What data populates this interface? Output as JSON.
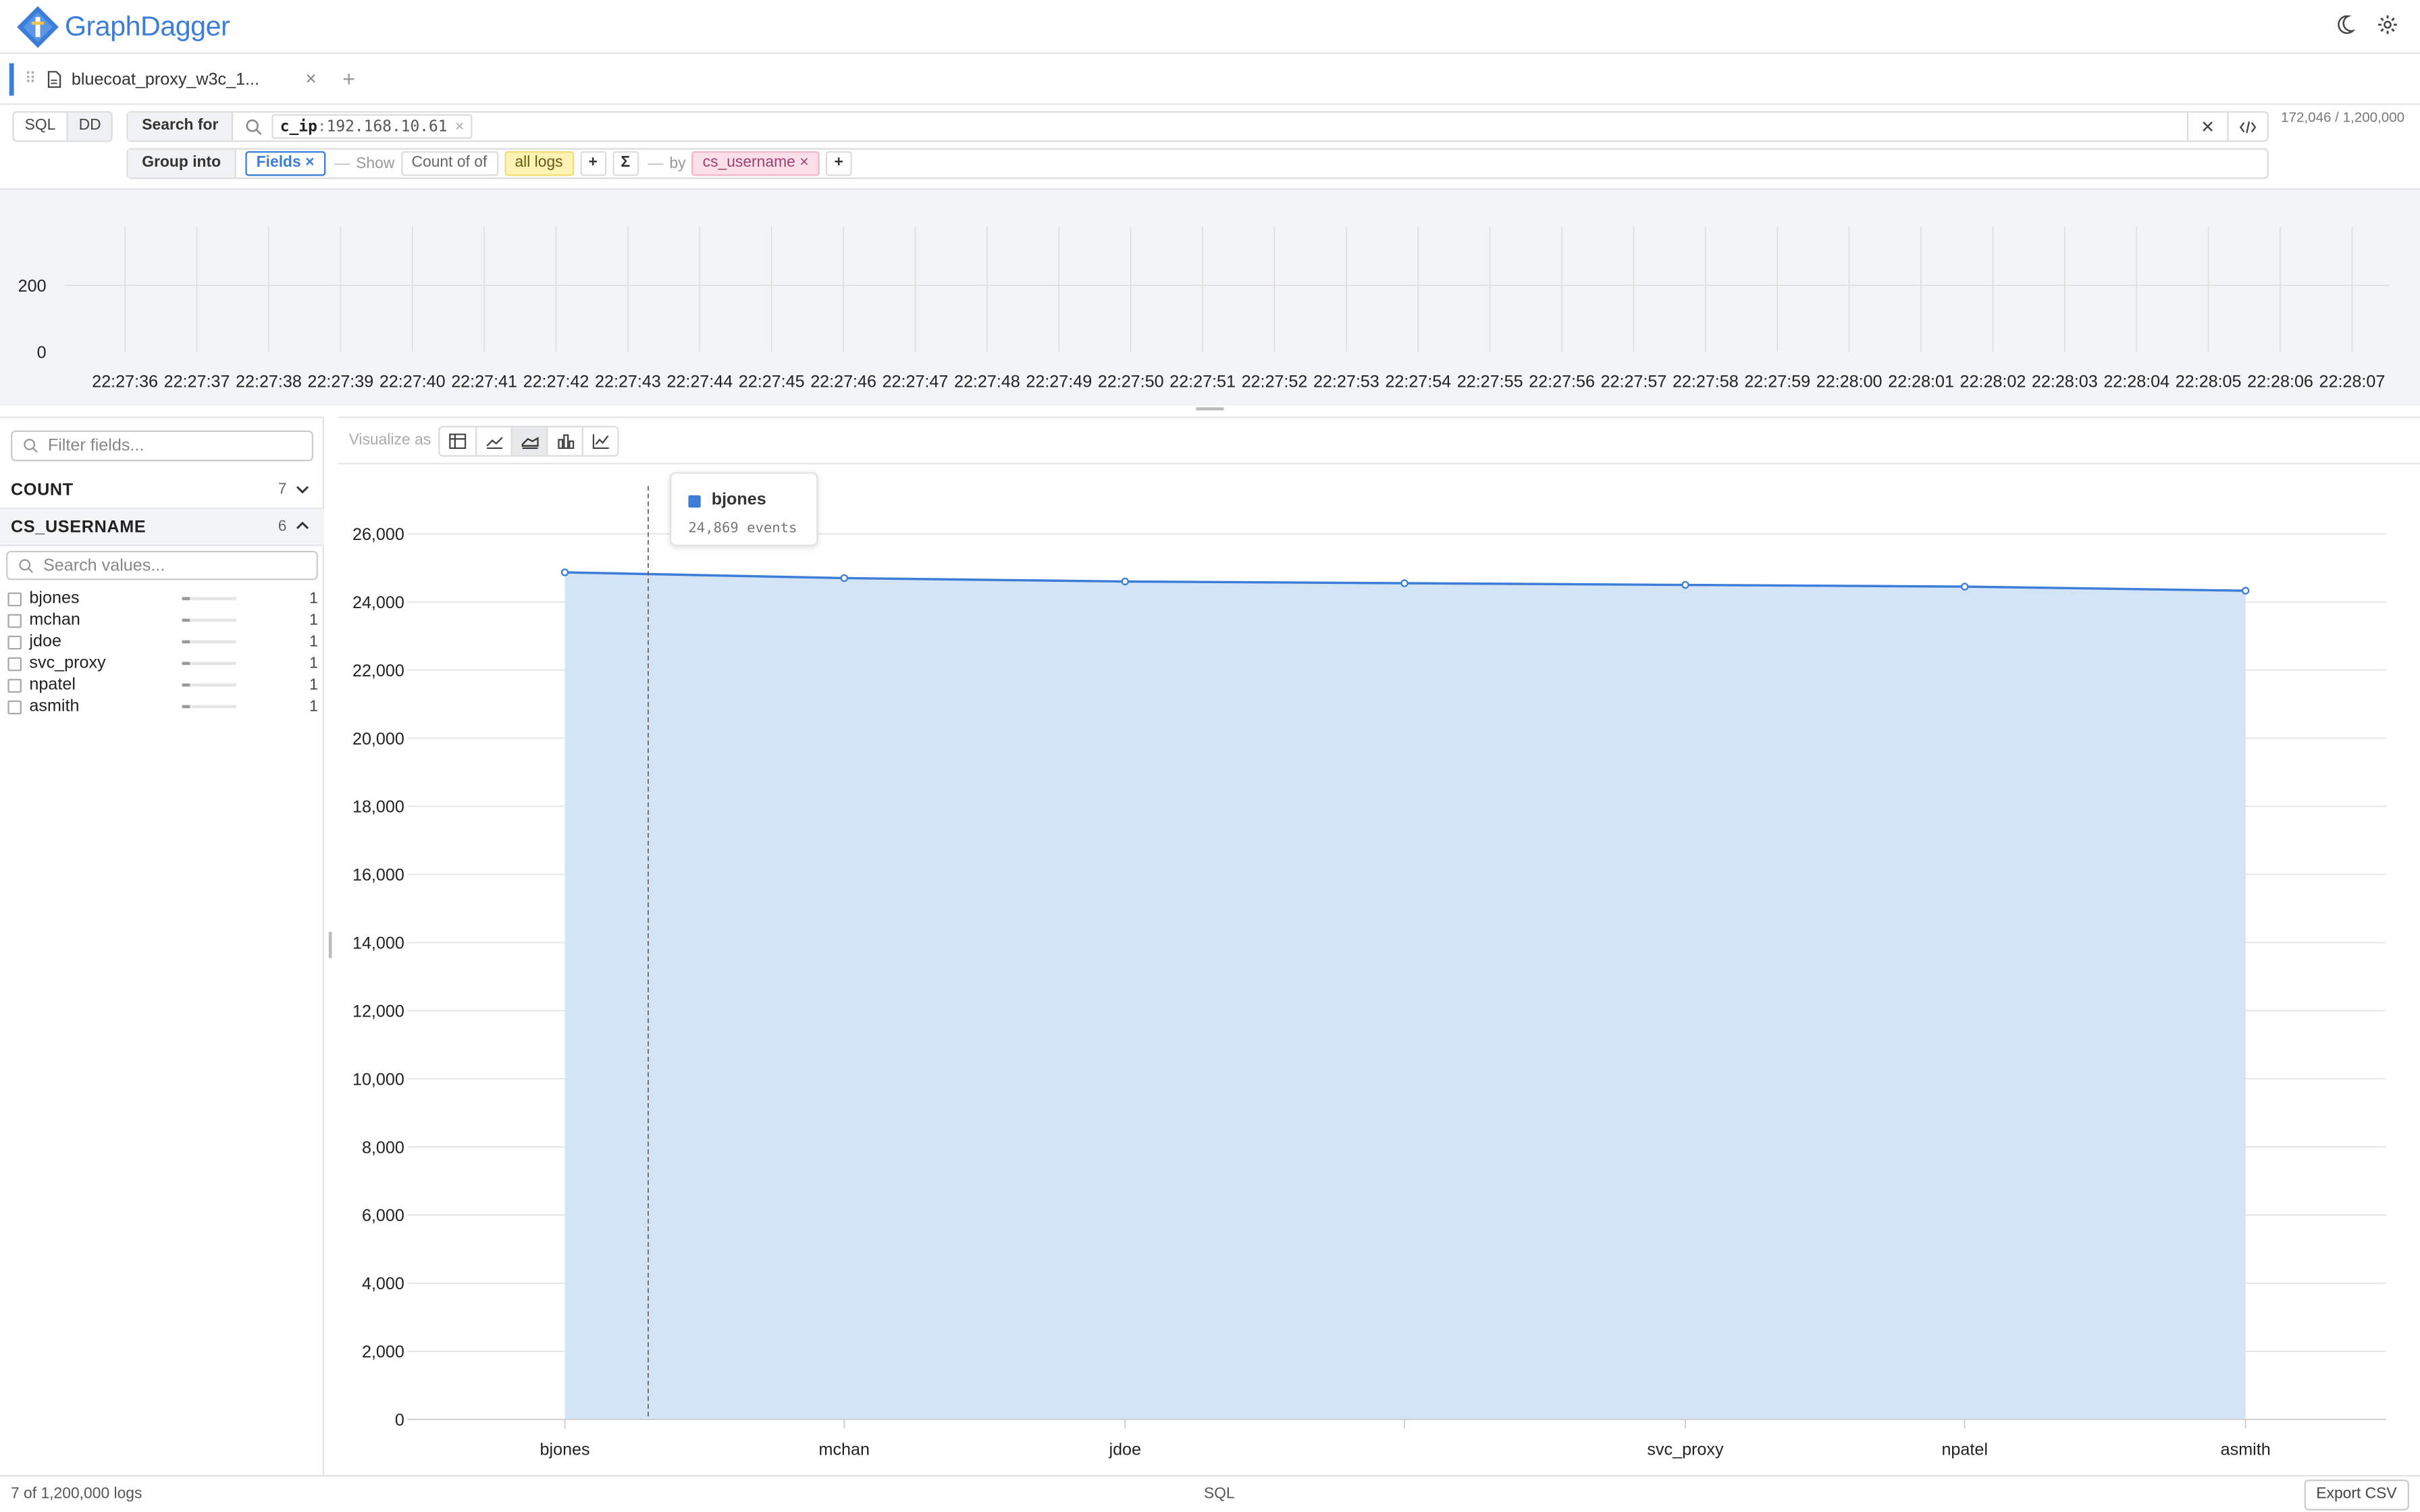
{
  "app": {
    "name": "GraphDagger"
  },
  "tabs": [
    {
      "label": "bluecoat_proxy_w3c_1..."
    }
  ],
  "mode": {
    "sql": "SQL",
    "dd": "DD"
  },
  "search": {
    "label": "Search for",
    "chip_key": "c_ip",
    "chip_sep": ":",
    "chip_value": "192.168.10.61"
  },
  "counter": "172,046 / 1,200,000",
  "group": {
    "label": "Group into",
    "fields_chip": "Fields",
    "show_word": "Show",
    "metric": "Count of of",
    "scope": "all logs",
    "plus": "+",
    "sigma": "Σ",
    "by_word": "by",
    "by_field": "cs_username",
    "plus2": "+"
  },
  "histogram": {
    "y_ticks": [
      "200",
      "0"
    ],
    "x_ticks": [
      "22:27:36",
      "22:27:37",
      "22:27:38",
      "22:27:39",
      "22:27:40",
      "22:27:41",
      "22:27:42",
      "22:27:43",
      "22:27:44",
      "22:27:45",
      "22:27:46",
      "22:27:47",
      "22:27:48",
      "22:27:49",
      "22:27:50",
      "22:27:51",
      "22:27:52",
      "22:27:53",
      "22:27:54",
      "22:27:55",
      "22:27:56",
      "22:27:57",
      "22:27:58",
      "22:27:59",
      "22:28:00",
      "22:28:01",
      "22:28:02",
      "22:28:03",
      "22:28:04",
      "22:28:05",
      "22:28:06",
      "22:28:07"
    ]
  },
  "sidebar": {
    "filter_placeholder": "Filter fields...",
    "fields": [
      {
        "name": "COUNT",
        "count": "7"
      },
      {
        "name": "CS_USERNAME",
        "count": "6"
      }
    ],
    "search_values_placeholder": "Search values...",
    "values": [
      {
        "label": "bjones",
        "count": "1",
        "share": 0.15
      },
      {
        "label": "mchan",
        "count": "1",
        "share": 0.15
      },
      {
        "label": "jdoe",
        "count": "1",
        "share": 0.15
      },
      {
        "label": "svc_proxy",
        "count": "1",
        "share": 0.15
      },
      {
        "label": "npatel",
        "count": "1",
        "share": 0.15
      },
      {
        "label": "asmith",
        "count": "1",
        "share": 0.15
      }
    ]
  },
  "viz": {
    "label": "Visualize as",
    "buttons": [
      "table-icon",
      "line-chart-icon",
      "area-chart-icon",
      "bar-chart-icon",
      "combo-chart-icon"
    ],
    "active": "area-chart-icon"
  },
  "tooltip": {
    "series": "bjones",
    "value_text": "24,869 events"
  },
  "chart_data": {
    "type": "area",
    "categories": [
      "bjones",
      "mchan",
      "jdoe",
      "",
      "svc_proxy",
      "npatel",
      "asmith"
    ],
    "values": [
      24869,
      24700,
      24600,
      24550,
      24500,
      24450,
      24330
    ],
    "ylim": [
      0,
      26000
    ],
    "y_ticks": [
      "0",
      "2,000",
      "4,000",
      "6,000",
      "8,000",
      "10,000",
      "12,000",
      "14,000",
      "16,000",
      "18,000",
      "20,000",
      "22,000",
      "24,000",
      "26,000"
    ],
    "grid": true,
    "color": "#3b7dd8",
    "fill": "#d4e4f7"
  },
  "footer": {
    "left": "7 of 1,200,000 logs",
    "mid": "SQL",
    "export": "Export CSV"
  }
}
